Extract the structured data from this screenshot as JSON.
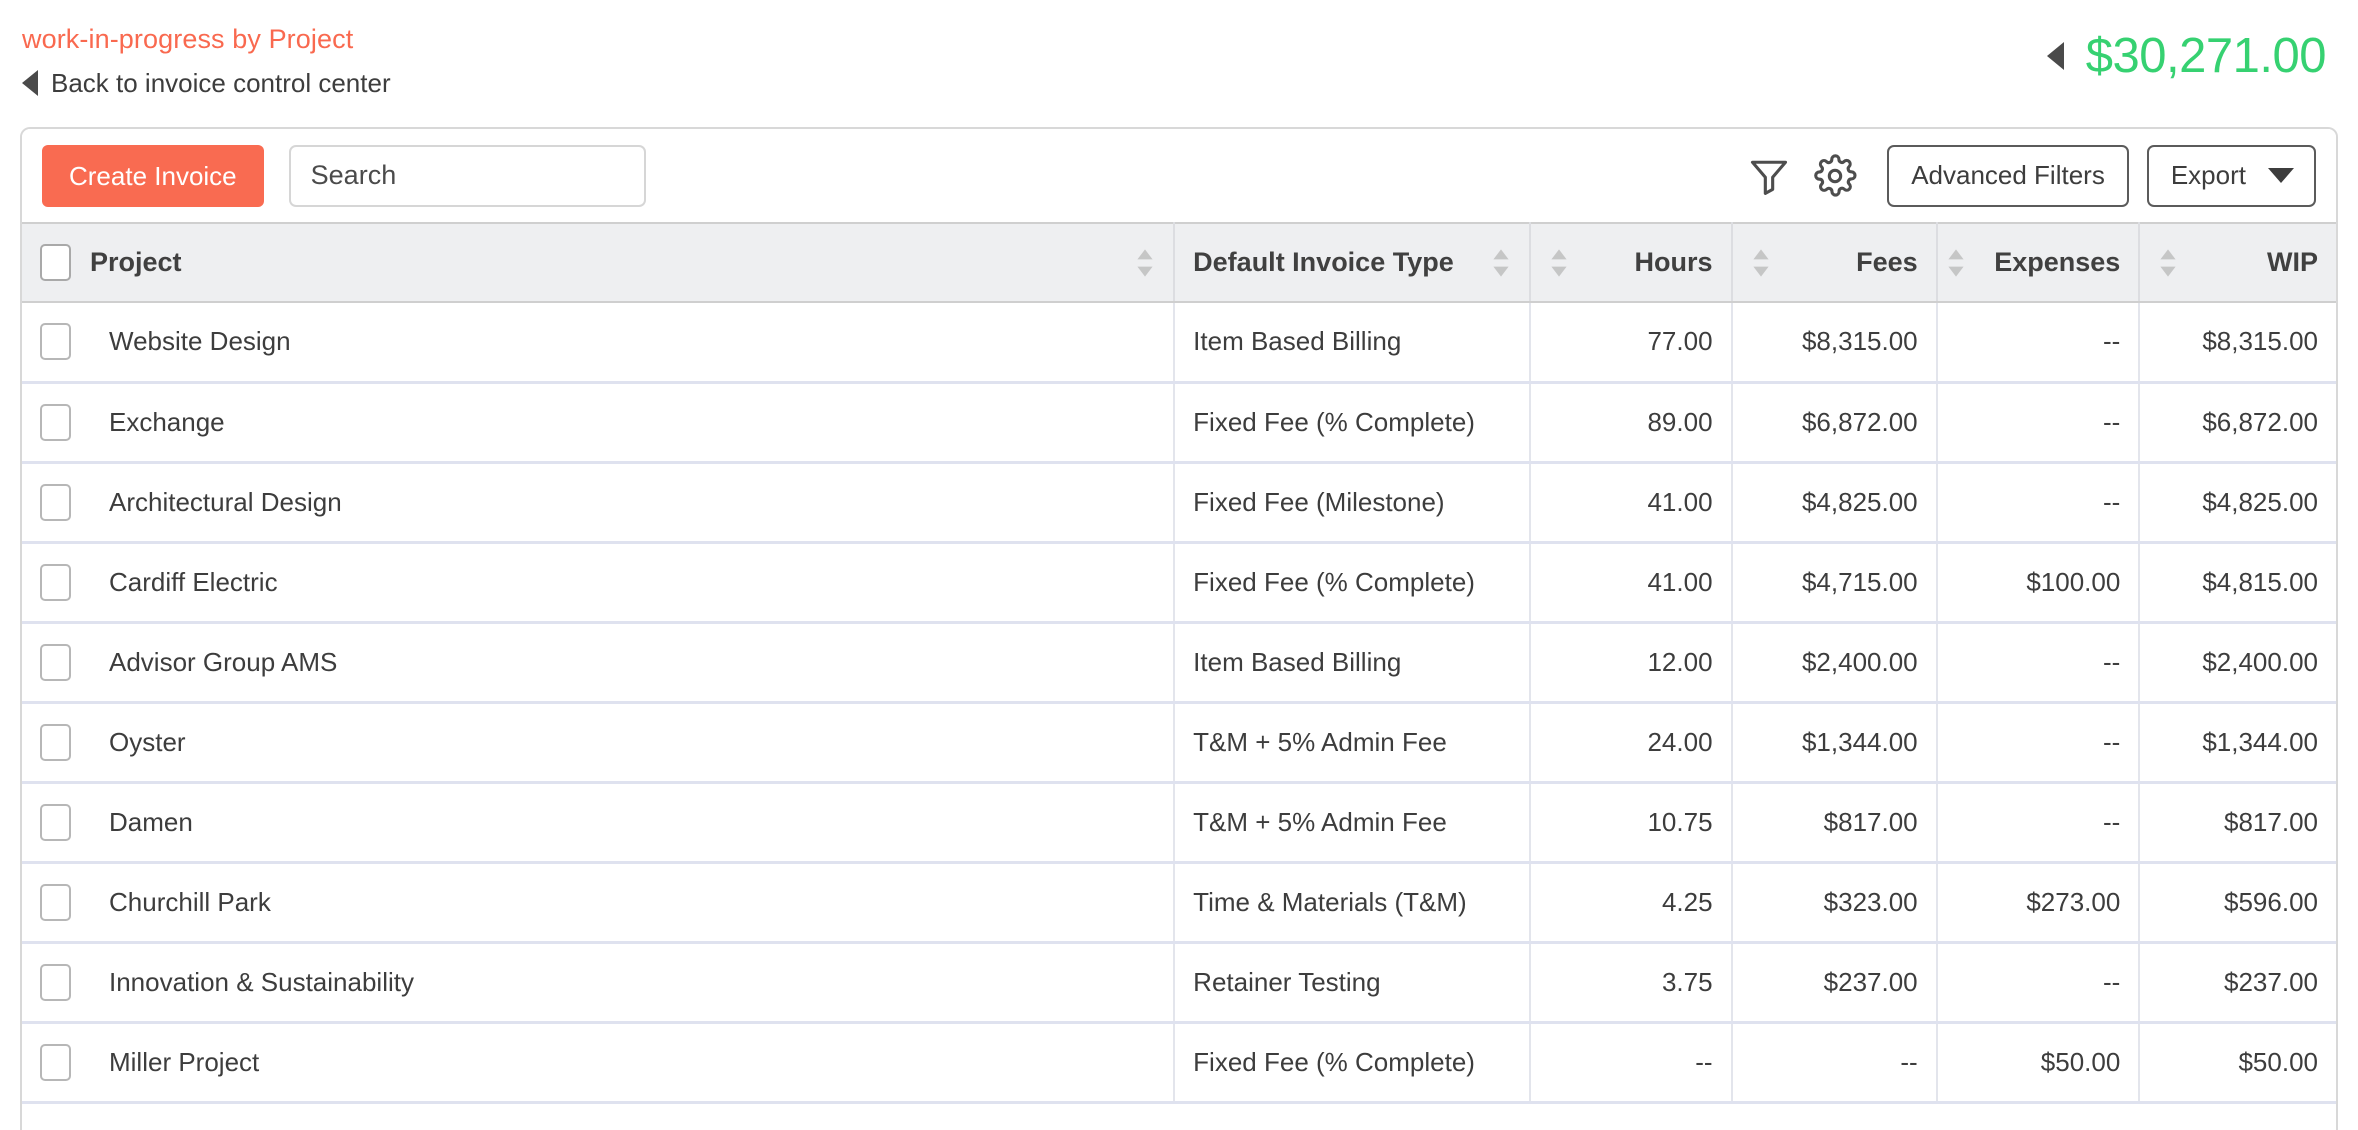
{
  "header": {
    "title": "work-in-progress by Project",
    "back_label": "Back to invoice control center",
    "total_amount": "$30,271.00",
    "accent_color": "#f9694f",
    "total_color": "#36d171"
  },
  "toolbar": {
    "create_label": "Create Invoice",
    "search_placeholder": "Search",
    "search_value": "",
    "advanced_filters_label": "Advanced Filters",
    "export_label": "Export",
    "filter_icon": "funnel-icon",
    "settings_icon": "gear-icon",
    "create_button_color": "#f96b51"
  },
  "table": {
    "columns": [
      {
        "key": "project",
        "label": "Project",
        "align": "left",
        "sortable": true
      },
      {
        "key": "type",
        "label": "Default Invoice Type",
        "align": "left",
        "sortable": true
      },
      {
        "key": "hours",
        "label": "Hours",
        "align": "right",
        "sortable": true
      },
      {
        "key": "fees",
        "label": "Fees",
        "align": "right",
        "sortable": true
      },
      {
        "key": "expenses",
        "label": "Expenses",
        "align": "right",
        "sortable": true
      },
      {
        "key": "wip",
        "label": "WIP",
        "align": "right",
        "sortable": true
      }
    ],
    "link_color": "#259bd0",
    "rows": [
      {
        "project": "Website Design",
        "type": "Item Based Billing",
        "hours": "77.00",
        "fees": "$8,315.00",
        "expenses": "--",
        "wip": "$8,315.00",
        "fees_link": true,
        "expenses_link": true,
        "wip_link": true
      },
      {
        "project": "Exchange",
        "type": "Fixed Fee (% Complete)",
        "hours": "89.00",
        "fees": "$6,872.00",
        "expenses": "--",
        "wip": "$6,872.00",
        "fees_link": true,
        "expenses_link": true,
        "wip_link": true
      },
      {
        "project": "Architectural Design",
        "type": "Fixed Fee (Milestone)",
        "hours": "41.00",
        "fees": "$4,825.00",
        "expenses": "--",
        "wip": "$4,825.00",
        "fees_link": true,
        "expenses_link": true,
        "wip_link": true
      },
      {
        "project": "Cardiff Electric",
        "type": "Fixed Fee (% Complete)",
        "hours": "41.00",
        "fees": "$4,715.00",
        "expenses": "$100.00",
        "wip": "$4,815.00",
        "fees_link": true,
        "expenses_link": true,
        "wip_link": true
      },
      {
        "project": "Advisor Group AMS",
        "type": "Item Based Billing",
        "hours": "12.00",
        "fees": "$2,400.00",
        "expenses": "--",
        "wip": "$2,400.00",
        "fees_link": true,
        "expenses_link": true,
        "wip_link": true
      },
      {
        "project": "Oyster",
        "type": "T&M + 5% Admin Fee",
        "hours": "24.00",
        "fees": "$1,344.00",
        "expenses": "--",
        "wip": "$1,344.00",
        "fees_link": true,
        "expenses_link": true,
        "wip_link": true
      },
      {
        "project": "Damen",
        "type": "T&M + 5% Admin Fee",
        "hours": "10.75",
        "fees": "$817.00",
        "expenses": "--",
        "wip": "$817.00",
        "fees_link": true,
        "expenses_link": true,
        "wip_link": true
      },
      {
        "project": "Churchill Park",
        "type": "Time & Materials (T&M)",
        "hours": "4.25",
        "fees": "$323.00",
        "expenses": "$273.00",
        "wip": "$596.00",
        "fees_link": true,
        "expenses_link": true,
        "wip_link": true
      },
      {
        "project": "Innovation & Sustainability",
        "type": "Retainer Testing",
        "hours": "3.75",
        "fees": "$237.00",
        "expenses": "--",
        "wip": "$237.00",
        "fees_link": true,
        "expenses_link": true,
        "wip_link": true
      },
      {
        "project": "Miller Project",
        "type": "Fixed Fee (% Complete)",
        "hours": "--",
        "fees": "--",
        "expenses": "$50.00",
        "wip": "$50.00",
        "fees_link": true,
        "expenses_link": true,
        "wip_link": true
      }
    ]
  }
}
